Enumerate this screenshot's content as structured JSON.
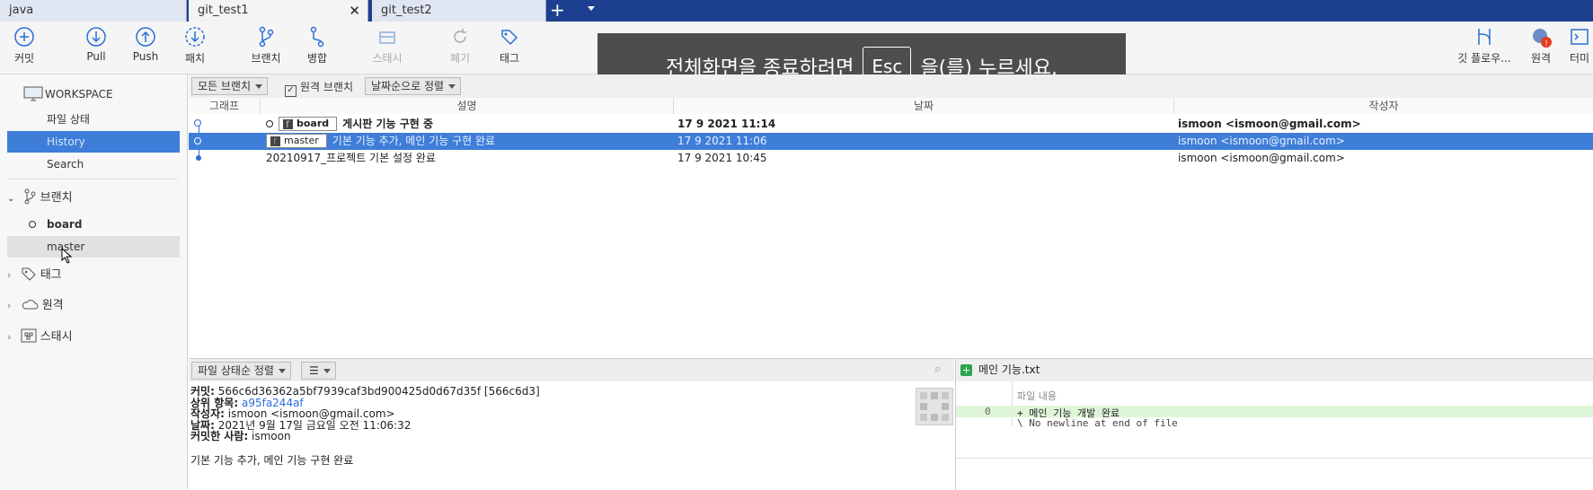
{
  "tabs": [
    {
      "label": "java"
    },
    {
      "label": "git_test1"
    },
    {
      "label": "git_test2"
    }
  ],
  "toolbar": {
    "commit": "커밋",
    "pull": "Pull",
    "push": "Push",
    "fetch": "패치",
    "branch": "브랜치",
    "merge": "병합",
    "stash": "스태시",
    "discard": "폐기",
    "tag": "태그",
    "gitflow": "깃 플로우...",
    "remote": "원격",
    "terminal": "터미"
  },
  "overlay": {
    "before": "전체화면을 종료하려면",
    "key": "Esc",
    "after": "을(를) 누르세요."
  },
  "sidebar": {
    "workspace": "WORKSPACE",
    "file_status": "파일 상태",
    "history": "History",
    "search": "Search",
    "branches": "브랜치",
    "branch_items": [
      "board",
      "master"
    ],
    "tags": "태그",
    "remotes": "원격",
    "stashes": "스태시"
  },
  "filters": {
    "all_branches": "모든 브랜치",
    "remote_branches": "원격 브랜치",
    "sort": "날짜순으로 정렬"
  },
  "columns": {
    "graph": "그래프",
    "description": "설명",
    "date": "날짜",
    "author": "작성자"
  },
  "commits": [
    {
      "tag": "board",
      "message": "게시판 기능 구현 중",
      "date": "17 9 2021 11:14",
      "author": "ismoon <ismoon@gmail.com>"
    },
    {
      "tag": "master",
      "message": "기본 기능 추가, 메인 기능 구현 완료",
      "date": "17 9 2021 11:06",
      "author": "ismoon <ismoon@gmail.com>"
    },
    {
      "tag": "",
      "message": "20210917_프로젝트 기본 설정 완료",
      "date": "17 9 2021 10:45",
      "author": "ismoon <ismoon@gmail.com>"
    }
  ],
  "file_sort": "파일 상태순 정렬",
  "details": {
    "commit_label": "커밋:",
    "commit_value": "566c6d36362a5bf7939caf3bd900425d0d67d35f [566c6d3]",
    "parent_label": "상위 항목:",
    "parent_value": "a95fa244af",
    "author_label": "작성자:",
    "author_value": "ismoon <ismoon@gmail.com>",
    "date_label": "날짜:",
    "date_value": "2021년 9월 17일 금요일 오전 11:06:32",
    "committer_label": "커밋한 사람:",
    "committer_value": "ismoon",
    "message": "기본 기능 추가, 메인 기능 구현 완료"
  },
  "diff": {
    "file_name": "메인 기능.txt",
    "header": "파일 내용",
    "line_no": "0",
    "added_line": "+ 메인 기능 개발 완료",
    "no_newline": "\\ No newline at end of file"
  }
}
